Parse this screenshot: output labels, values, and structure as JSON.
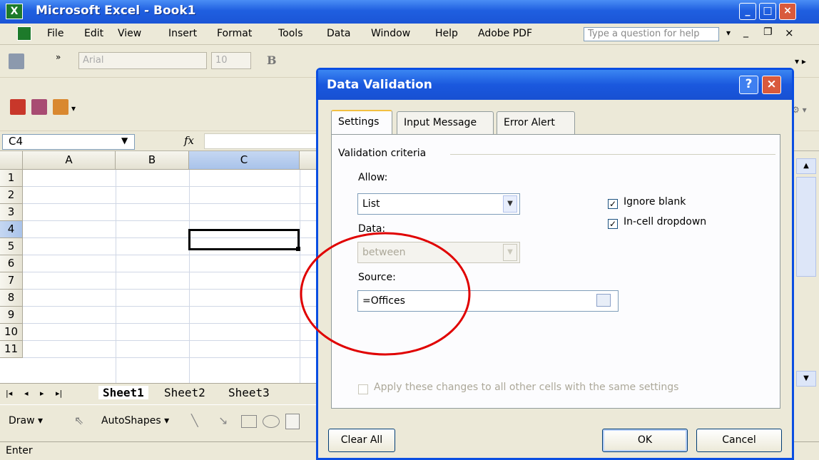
{
  "window": {
    "title": "Microsoft Excel - Book1"
  },
  "menu": {
    "items": [
      {
        "label": "File",
        "u": "F"
      },
      {
        "label": "Edit",
        "u": "E"
      },
      {
        "label": "View",
        "u": "V"
      },
      {
        "label": "Insert",
        "u": "I"
      },
      {
        "label": "Format",
        "u": "o"
      },
      {
        "label": "Tools",
        "u": "T"
      },
      {
        "label": "Data",
        "u": "D"
      },
      {
        "label": "Window",
        "u": "W"
      },
      {
        "label": "Help",
        "u": "H"
      },
      {
        "label": "Adobe PDF",
        "u": "b"
      }
    ],
    "help_placeholder": "Type a question for help"
  },
  "toolbar": {
    "font_name": "Arial",
    "font_size": "10",
    "bold_label": "B"
  },
  "formula_bar": {
    "name_box": "C4",
    "fx": "fx"
  },
  "grid": {
    "columns": [
      "A",
      "B",
      "C"
    ],
    "rows": [
      "1",
      "2",
      "3",
      "4",
      "5",
      "6",
      "7",
      "8",
      "9",
      "10",
      "11"
    ],
    "selected_cell": "C4"
  },
  "sheet_tabs": [
    "Sheet1",
    "Sheet2",
    "Sheet3"
  ],
  "drawing": {
    "draw_label": "Draw",
    "autoshapes_label": "AutoShapes"
  },
  "status": {
    "mode": "Enter"
  },
  "dialog": {
    "title": "Data Validation",
    "tabs": [
      "Settings",
      "Input Message",
      "Error Alert"
    ],
    "active_tab": "Settings",
    "group_label": "Validation criteria",
    "allow_label": "Allow:",
    "allow_value": "List",
    "data_label": "Data:",
    "data_value": "between",
    "source_label": "Source:",
    "source_value": "=Offices",
    "ignore_blank_label": "Ignore blank",
    "ignore_blank_checked": true,
    "incell_label": "In-cell dropdown",
    "incell_checked": true,
    "apply_label": "Apply these changes to all other cells with the same settings",
    "clear_all_label": "Clear All",
    "ok_label": "OK",
    "cancel_label": "Cancel"
  },
  "annotation": {
    "highlight_color": "#e00000"
  }
}
